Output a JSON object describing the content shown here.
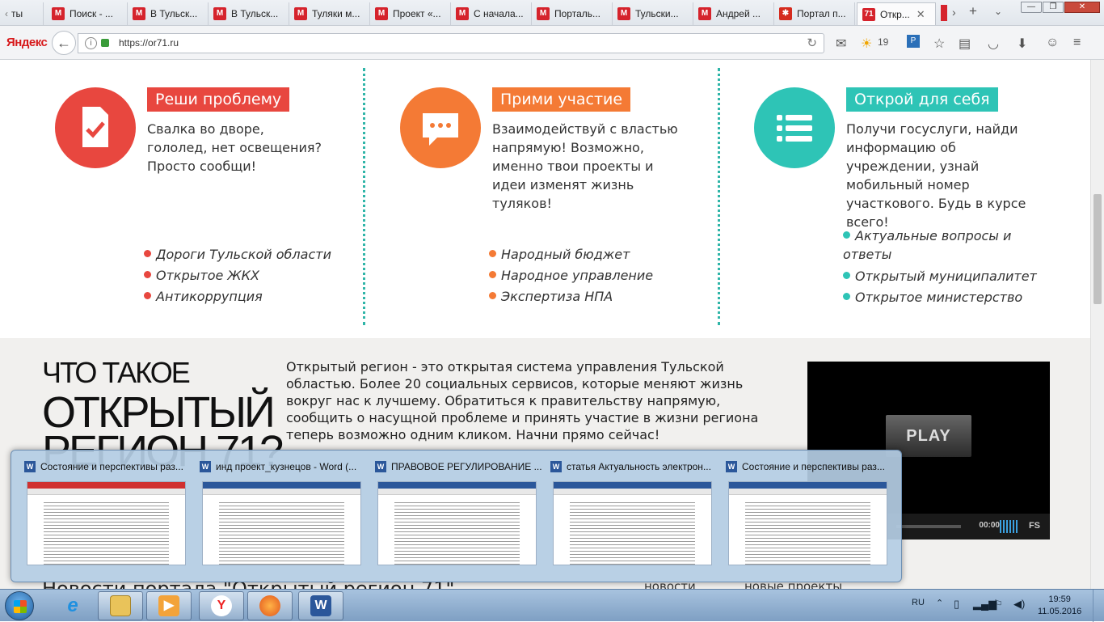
{
  "browser": {
    "tabs": [
      {
        "title": "ты"
      },
      {
        "title": "Поиск - ..."
      },
      {
        "title": "В Тульск..."
      },
      {
        "title": "В Тульск..."
      },
      {
        "title": "Туляки м..."
      },
      {
        "title": "Проект «..."
      },
      {
        "title": "С начала..."
      },
      {
        "title": "Порталь..."
      },
      {
        "title": "Тульски..."
      },
      {
        "title": "Андрей ..."
      },
      {
        "title": "Портал п..."
      },
      {
        "title": "Откр..."
      }
    ],
    "active_tab_icon": "71",
    "logo": "Яндекс",
    "url": "https://or71.ru",
    "weather": "19",
    "new_tab": "+"
  },
  "columns": [
    {
      "badge": "Реши проблему",
      "color": "#e8473f",
      "icon": "document-check-icon",
      "text": "Свалка во дворе, гололед, нет освещения? Просто сообщи!",
      "links": [
        "Дороги Тульской области",
        "Открытое ЖКХ",
        "Антикоррупция"
      ]
    },
    {
      "badge": "Прими участие",
      "color": "#f47a35",
      "icon": "chat-bubble-icon",
      "text": "Взаимодействуй с властью напрямую! Возможно, именно твои проекты и идеи изменят жизнь туляков!",
      "links": [
        "Народный бюджет",
        "Народное управление",
        "Экспертиза НПА"
      ]
    },
    {
      "badge": "Открой для себя",
      "color": "#2ec4b6",
      "icon": "list-icon",
      "text": "Получи госуслуги, найди информацию об учреждении, узнай мобильный номер участкового. Будь в курсе всего!",
      "links": [
        "Актуальные вопросы и ответы",
        "Открытый муниципалитет",
        "Открытое министерство"
      ]
    }
  ],
  "about": {
    "title_line1": "ЧТО ТАКОЕ",
    "title_line2": "ОТКРЫТЫЙ",
    "title_line3": "РЕГИОН 71?",
    "intro": "Открытый регион - это открытая система управления Тульской областью. Более 20 социальных сервисов, которые меняют жизнь вокруг нас к лучшему. Обратиться к правительству напрямую, сообщить о насущной проблеме и принять участие в жизни региона теперь возможно одним кликом. Начни прямо сейчас!"
  },
  "video": {
    "play_label": "PLAY",
    "time": "00:00",
    "fs_label": "FS"
  },
  "news": {
    "heading": "Новости портала \"Открытый регион 71\"",
    "tab_news": "новости",
    "tab_projects": "новые проекты"
  },
  "taskbar_preview": [
    {
      "title": "Состояние и перспективы раз..."
    },
    {
      "title": "инд проект_кузнецов - Word (..."
    },
    {
      "title": "ПРАВОВОЕ РЕГУЛИРОВАНИЕ ..."
    },
    {
      "title": "статья Актуальность электрон..."
    },
    {
      "title": "Состояние и перспективы раз..."
    }
  ],
  "taskbar": {
    "lang": "RU",
    "time": "19:59",
    "date": "11.05.2016",
    "apps": [
      "internet-explorer-icon",
      "file-explorer-icon",
      "media-player-icon",
      "yandex-browser-icon",
      "firefox-icon",
      "word-icon"
    ]
  }
}
